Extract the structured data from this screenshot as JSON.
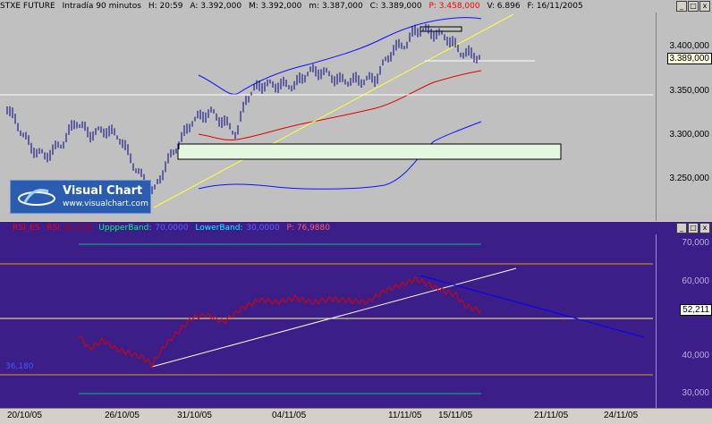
{
  "top_header": {
    "symbol": "STXE FUTURE",
    "timeframe": "Intradía 90 minutos",
    "h": "H: 20:59",
    "a": "A: 3.392,000",
    "m_big": "M: 3.392,000",
    "m_small": "m: 3.387,000",
    "c": "C: 3.389,000",
    "p": "P: 3.458,000",
    "v": "V: 6.896",
    "f": "F: 16/11/2005",
    "colors": {
      "text": "#000000",
      "p": "#ff0000"
    }
  },
  "top_axis": {
    "labels": [
      "3.400,000",
      "3.350,000",
      "3.300,000",
      "3.250,000"
    ],
    "current_price": "3.389,000"
  },
  "bottom_header": {
    "rsi_name": "RSI_ES",
    "rsi_label": "RSI",
    "rsi_value": "52,210",
    "upper_label": "UppperBand:",
    "upper_value": "70,0000",
    "lower_label": "LowerBand:",
    "lower_value": "30,0000",
    "p_value": "P: 76,9880",
    "colors": {
      "rsi": "#ff0000",
      "upper": "#00ffff",
      "lower": "#00ff80",
      "p": "#ff6060"
    }
  },
  "bottom_axis": {
    "labels": [
      "70,000",
      "60,000",
      "40,000",
      "30,000"
    ],
    "current_rsi": "52,211",
    "left_marker": "36,180"
  },
  "x_axis": {
    "labels": [
      "20/10/05",
      "26/10/05",
      "31/10/05",
      "04/11/05",
      "11/11/05",
      "15/11/05",
      "21/11/05",
      "24/11/05"
    ]
  },
  "logo": {
    "title": "Visual Chart",
    "url": "www.visualchart.com"
  },
  "window_buttons": [
    "_",
    "□",
    "x"
  ]
}
